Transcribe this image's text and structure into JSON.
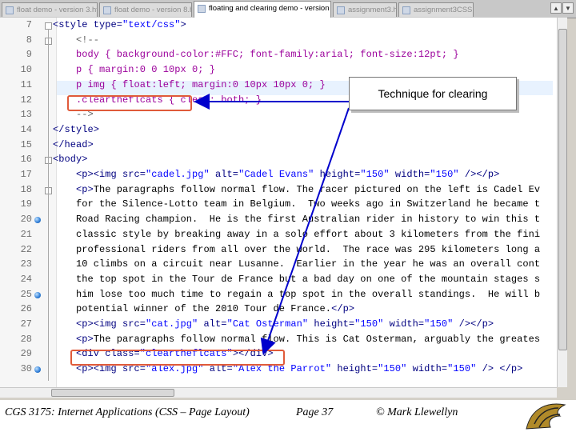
{
  "tabs": [
    {
      "label": "float demo - version 3.html",
      "active": false
    },
    {
      "label": "float demo - version 8.html",
      "active": false
    },
    {
      "label": "floating and clearing demo - version 2.html",
      "active": true
    },
    {
      "label": "assignment3.htm",
      "active": false
    },
    {
      "label": "assignment3CSS.css",
      "active": false
    }
  ],
  "editor": {
    "lines": [
      {
        "n": "7",
        "t": [
          [
            "tag",
            "<style "
          ],
          [
            "attr",
            "type="
          ],
          [
            "str",
            "\"text/css\""
          ],
          [
            "tag",
            ">"
          ]
        ]
      },
      {
        "n": "8",
        "t": [
          [
            "com",
            "    <!--"
          ]
        ]
      },
      {
        "n": "9",
        "t": [
          [
            "css",
            "    body { background-color:#FFC; font-family:arial; font-size:12pt; }"
          ]
        ]
      },
      {
        "n": "10",
        "t": [
          [
            "css",
            "    p { margin:0 0 10px 0; }"
          ]
        ]
      },
      {
        "n": "11",
        "t": [
          [
            "css",
            "    p img { float:left; margin:0 10px 10px 0; }"
          ]
        ]
      },
      {
        "n": "12",
        "t": [
          [
            "css",
            "    .cleartheflcats { clear: both; }"
          ]
        ]
      },
      {
        "n": "13",
        "t": [
          [
            "com",
            "    -->"
          ]
        ]
      },
      {
        "n": "14",
        "t": [
          [
            "tag",
            "</style>"
          ]
        ]
      },
      {
        "n": "15",
        "t": [
          [
            "tag",
            "</head>"
          ]
        ]
      },
      {
        "n": "16",
        "t": [
          [
            "tag",
            "<body>"
          ]
        ]
      },
      {
        "n": "17",
        "t": [
          [
            "tag",
            "    <p><img "
          ],
          [
            "attr",
            "src="
          ],
          [
            "str",
            "\"cadel.jpg\""
          ],
          [
            "attr",
            " alt="
          ],
          [
            "str",
            "\"Cadel Evans\""
          ],
          [
            "attr",
            " height="
          ],
          [
            "str",
            "\"150\""
          ],
          [
            "attr",
            " width="
          ],
          [
            "str",
            "\"150\""
          ],
          [
            "tag",
            " /></p>"
          ]
        ]
      },
      {
        "n": "18",
        "t": [
          [
            "tag",
            "    <p>"
          ],
          [
            "txt",
            "The paragraphs follow normal flow. The racer pictured on the left is Cadel Ev"
          ]
        ]
      },
      {
        "n": "19",
        "t": [
          [
            "txt",
            "    for the Silence-Lotto team in Belgium.  Two weeks ago in Switzerland he became t"
          ]
        ]
      },
      {
        "n": "20",
        "t": [
          [
            "txt",
            "    Road Racing champion.  He is the first Australian rider in history to win this t"
          ]
        ]
      },
      {
        "n": "21",
        "t": [
          [
            "txt",
            "    classic style by breaking away in a solo effort about 3 kilometers from the fini"
          ]
        ]
      },
      {
        "n": "22",
        "t": [
          [
            "txt",
            "    professional riders from all over the world.  The race was 295 kilometers long a"
          ]
        ]
      },
      {
        "n": "23",
        "t": [
          [
            "txt",
            "    10 climbs on a circuit near Lusanne.  Earlier in the year he was an overall cont"
          ]
        ]
      },
      {
        "n": "24",
        "t": [
          [
            "txt",
            "    the top spot in the Tour de France but a bad day on one of the mountain stages s"
          ]
        ]
      },
      {
        "n": "25",
        "t": [
          [
            "txt",
            "    him lose too much time to regain a top spot in the overall standings.  He will b"
          ]
        ]
      },
      {
        "n": "26",
        "t": [
          [
            "txt",
            "    potential winner of the 2010 Tour de France."
          ],
          [
            "tag",
            "</p>"
          ]
        ]
      },
      {
        "n": "27",
        "t": [
          [
            "tag",
            "    <p><img "
          ],
          [
            "attr",
            "src="
          ],
          [
            "str",
            "\"cat.jpg\""
          ],
          [
            "attr",
            " alt="
          ],
          [
            "str",
            "\"Cat Osterman\""
          ],
          [
            "attr",
            " height="
          ],
          [
            "str",
            "\"150\""
          ],
          [
            "attr",
            " width="
          ],
          [
            "str",
            "\"150\""
          ],
          [
            "tag",
            " /></p>"
          ]
        ]
      },
      {
        "n": "28",
        "t": [
          [
            "tag",
            "    <p>"
          ],
          [
            "txt",
            "The paragraphs follow normal flow. This is Cat Osterman, arguably the greates"
          ]
        ]
      },
      {
        "n": "29",
        "t": [
          [
            "tag",
            "    <div "
          ],
          [
            "attr",
            "class="
          ],
          [
            "str",
            "\"cleartheflcats\""
          ],
          [
            "tag",
            "></div>"
          ]
        ]
      },
      {
        "n": "30",
        "t": [
          [
            "tag",
            "    <p><img "
          ],
          [
            "attr",
            "src="
          ],
          [
            "str",
            "\"alex.jpg\""
          ],
          [
            "attr",
            " alt="
          ],
          [
            "str",
            "\"Alex the Parrot\""
          ],
          [
            "attr",
            " height="
          ],
          [
            "str",
            "\"150\""
          ],
          [
            "attr",
            " width="
          ],
          [
            "str",
            "\"150\""
          ],
          [
            "tag",
            " /> </p>"
          ]
        ]
      }
    ]
  },
  "callout": {
    "text": "Technique for clearing"
  },
  "footer": {
    "course": "CGS 3175: Internet Applications (CSS – Page Layout)",
    "page": "Page 37",
    "author": "© Mark Llewellyn"
  },
  "colors": {
    "accent_red": "#e05a3a",
    "arrow_blue": "#0000cc",
    "highlight_line": "#e8f2fe"
  },
  "icons": {
    "tab": "document-icon",
    "breakpoint": "bookmark-icon",
    "logo": "university-logo"
  }
}
